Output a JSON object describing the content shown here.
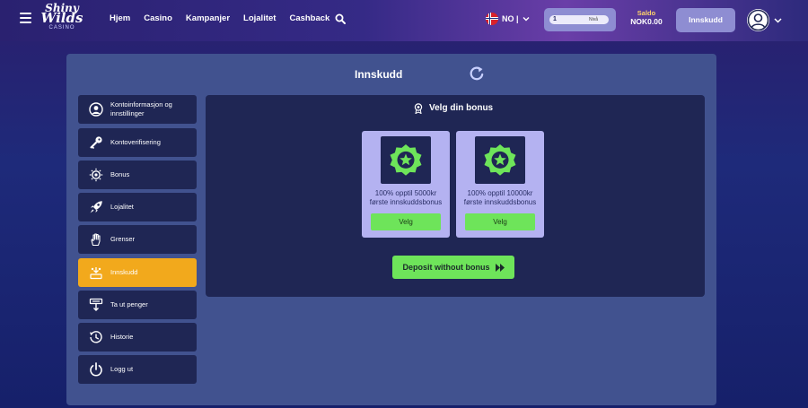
{
  "header": {
    "logo": {
      "line1": "Shiny",
      "line2": "Wilds",
      "line3": "CASINO"
    },
    "nav": [
      "Hjem",
      "Casino",
      "Kampanjer",
      "Lojalitet",
      "Cashback"
    ],
    "language": "NO |",
    "level": {
      "number": "1",
      "label": "Nivå",
      "progress": 0
    },
    "balance_label": "Saldo",
    "balance_value": "NOK0.00",
    "deposit_label": "Innskudd"
  },
  "page": {
    "title": "Innskudd"
  },
  "sidebar": {
    "items": [
      {
        "label": "Kontoinformasjon og innstillinger",
        "icon": "user-circle-icon",
        "active": false
      },
      {
        "label": "Kontoverifisering",
        "icon": "key-icon",
        "active": false
      },
      {
        "label": "Bonus",
        "icon": "bonus-coin-icon",
        "active": false
      },
      {
        "label": "Lojalitet",
        "icon": "rocket-icon",
        "active": false
      },
      {
        "label": "Grenser",
        "icon": "hand-stop-icon",
        "active": false
      },
      {
        "label": "Innskudd",
        "icon": "deposit-icon",
        "active": true
      },
      {
        "label": "Ta ut penger",
        "icon": "withdraw-icon",
        "active": false
      },
      {
        "label": "Historie",
        "icon": "history-icon",
        "active": false
      },
      {
        "label": "Logg ut",
        "icon": "power-icon",
        "active": false
      }
    ]
  },
  "bonus_section": {
    "title": "Velg din bonus",
    "cards": [
      {
        "desc_line1": "100% opptil 5000kr",
        "desc_line2": "første innskuddsbonus",
        "button": "Velg"
      },
      {
        "desc_line1": "100% opptil 10000kr",
        "desc_line2": "første innskuddsbonus",
        "button": "Velg"
      }
    ],
    "no_bonus_button": "Deposit without bonus"
  },
  "colors": {
    "accent_green": "#6ee45a",
    "active_orange": "#f2a91c",
    "card_lavender": "#b4b2f1",
    "dark_panel": "#1f2654"
  }
}
